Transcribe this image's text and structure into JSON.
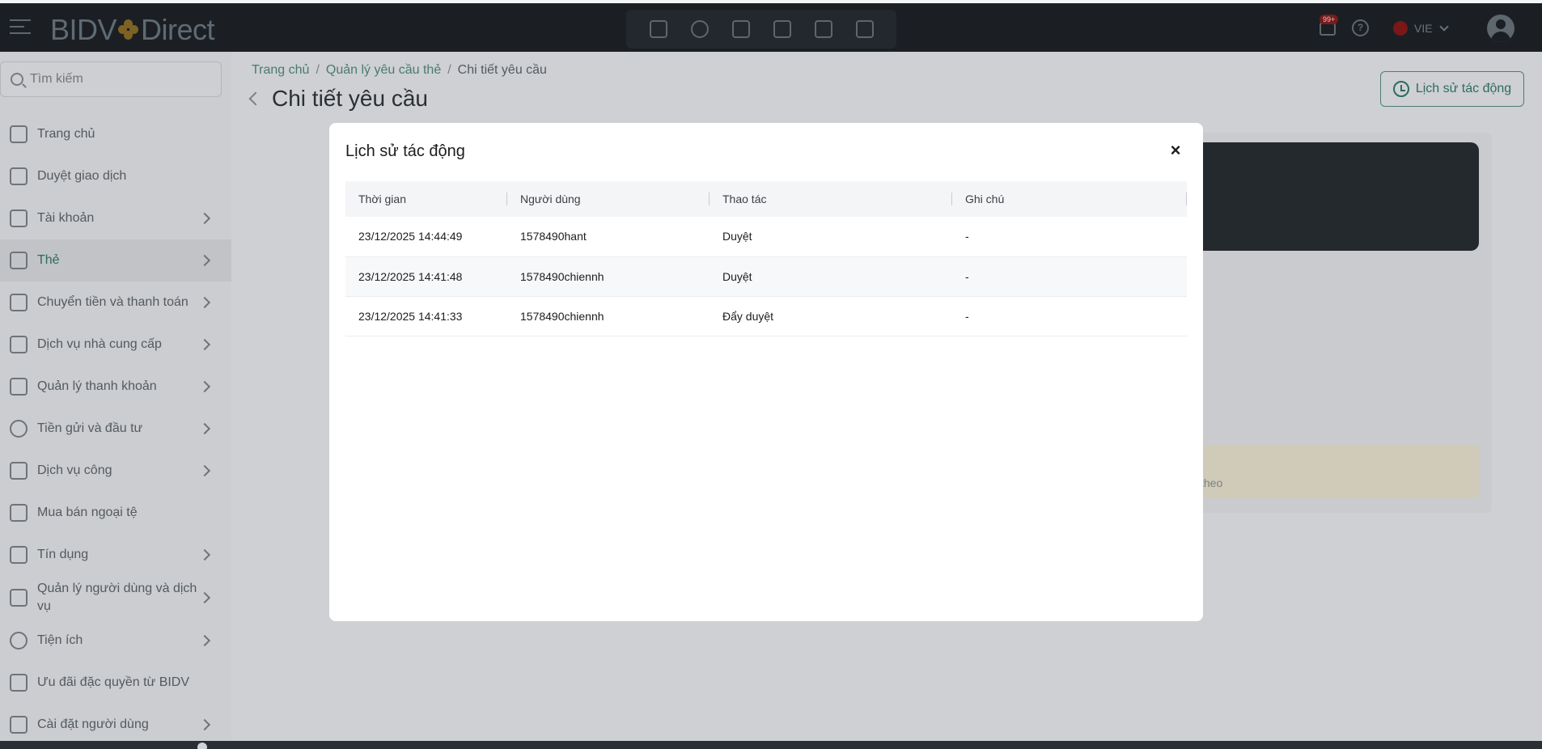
{
  "header": {
    "logo_left": "BIDV",
    "logo_right": "Direct",
    "notification_badge": "99+",
    "help_symbol": "?",
    "language": "VIE"
  },
  "sidebar": {
    "search_placeholder": "Tìm kiếm",
    "items": [
      {
        "label": "Trang chủ",
        "icon": "home-icon",
        "chevron": false
      },
      {
        "label": "Duyệt giao dịch",
        "icon": "approve-document-icon",
        "chevron": false
      },
      {
        "label": "Tài khoản",
        "icon": "account-icon",
        "chevron": true
      },
      {
        "label": "Thẻ",
        "icon": "card-icon",
        "chevron": true,
        "active": true
      },
      {
        "label": "Chuyển tiền và thanh toán",
        "icon": "transfer-icon",
        "chevron": true
      },
      {
        "label": "Dịch vụ nhà cung cấp",
        "icon": "provider-icon",
        "chevron": true
      },
      {
        "label": "Quản lý thanh khoản",
        "icon": "liquidity-icon",
        "chevron": true
      },
      {
        "label": "Tiền gửi và đầu tư",
        "icon": "deposit-icon",
        "chevron": true
      },
      {
        "label": "Dịch vụ công",
        "icon": "public-service-icon",
        "chevron": true
      },
      {
        "label": "Mua bán ngoại tệ",
        "icon": "forex-icon",
        "chevron": false
      },
      {
        "label": "Tín dụng",
        "icon": "credit-icon",
        "chevron": true
      },
      {
        "label": "Quản lý người dùng và dịch vụ",
        "icon": "user-management-icon",
        "chevron": true
      },
      {
        "label": "Tiện ích",
        "icon": "utility-icon",
        "chevron": true
      },
      {
        "label": "Ưu đãi đặc quyền từ BIDV",
        "icon": "privilege-icon",
        "chevron": false
      },
      {
        "label": "Cài đặt người dùng",
        "icon": "user-settings-icon",
        "chevron": true
      }
    ]
  },
  "breadcrumb": {
    "home": "Trang chủ",
    "parent": "Quản lý yêu cầu thẻ",
    "current": "Chi tiết yêu cầu",
    "separator": "/"
  },
  "page": {
    "title": "Chi tiết yêu cầu",
    "history_button": "Lịch sử tác động",
    "background_text": "theo"
  },
  "modal": {
    "title": "Lịch sử tác động",
    "close_symbol": "×",
    "columns": [
      "Thời gian",
      "Người dùng",
      "Thao tác",
      "Ghi chú"
    ],
    "rows": [
      {
        "time": "23/12/2025 14:44:49",
        "user": "1578490hant",
        "action": "Duyệt",
        "note": "-"
      },
      {
        "time": "23/12/2025 14:41:48",
        "user": "1578490chiennh",
        "action": "Duyệt",
        "note": "-"
      },
      {
        "time": "23/12/2025 14:41:33",
        "user": "1578490chiennh",
        "action": "Đẩy duyệt",
        "note": "-"
      }
    ]
  },
  "colors": {
    "accent": "#2e6b5e",
    "header_bg": "#1b1f24",
    "brand_gold": "#c69b2a"
  }
}
